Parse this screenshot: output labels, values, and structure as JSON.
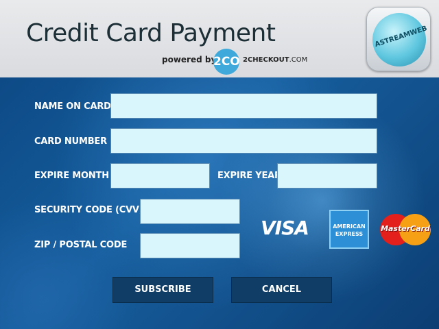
{
  "header": {
    "title": "Credit Card Payment",
    "powered_by": "powered by",
    "provider_logo": "2CO",
    "provider_name": "2CHECKOUT",
    "provider_domain": ".COM",
    "app_icon_brand": "ASTREAMWEB"
  },
  "form": {
    "name_on_card": {
      "label": "NAME ON CARD",
      "value": ""
    },
    "card_number": {
      "label": "CARD NUMBER",
      "value": ""
    },
    "expire_month": {
      "label": "EXPIRE MONTH",
      "value": ""
    },
    "expire_year": {
      "label": "EXPIRE YEAR",
      "value": ""
    },
    "security_code": {
      "label": "SECURITY CODE (CVV)",
      "value": ""
    },
    "zip_code": {
      "label": "ZIP  /  POSTAL CODE",
      "value": ""
    }
  },
  "card_logos": {
    "visa": "VISA",
    "amex_line1": "AMERICAN",
    "amex_line2": "EXPRESS",
    "mastercard": "MasterCard"
  },
  "buttons": {
    "subscribe": "SUBSCRIBE",
    "cancel": "CANCEL"
  },
  "colors": {
    "header_bg": "#e2e3e6",
    "main_bg": "#0d4a86",
    "field_bg": "#d9f6fd",
    "button_bg": "#0f3d66"
  }
}
